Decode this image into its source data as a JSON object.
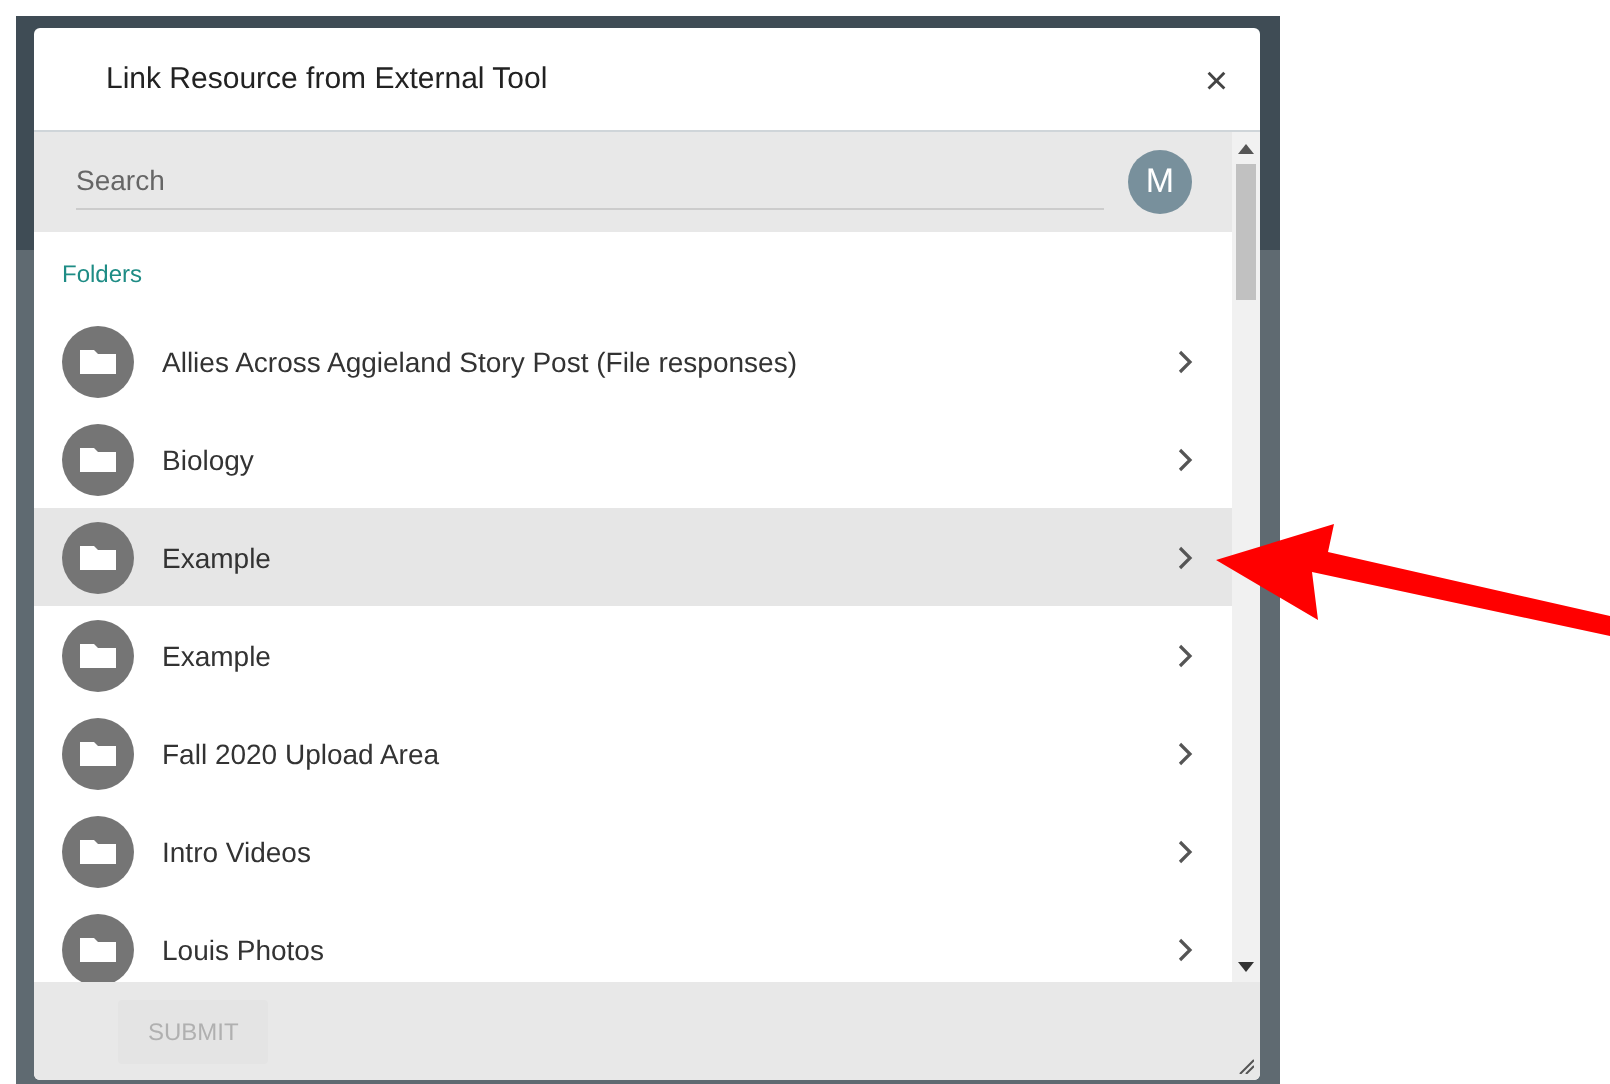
{
  "dialog": {
    "title": "Link Resource from External Tool",
    "close": "×"
  },
  "search": {
    "placeholder": "Search"
  },
  "avatar": {
    "initial": "M"
  },
  "section_label": "Folders",
  "folders": [
    {
      "name": "Allies Across Aggieland Story Post (File responses)",
      "selected": false
    },
    {
      "name": "Biology",
      "selected": false
    },
    {
      "name": "Example",
      "selected": true
    },
    {
      "name": "Example",
      "selected": false
    },
    {
      "name": "Fall 2020 Upload Area",
      "selected": false
    },
    {
      "name": "Intro Videos",
      "selected": false
    },
    {
      "name": "Louis Photos",
      "selected": false
    }
  ],
  "submit": {
    "label": "SUBMIT",
    "disabled": true
  }
}
